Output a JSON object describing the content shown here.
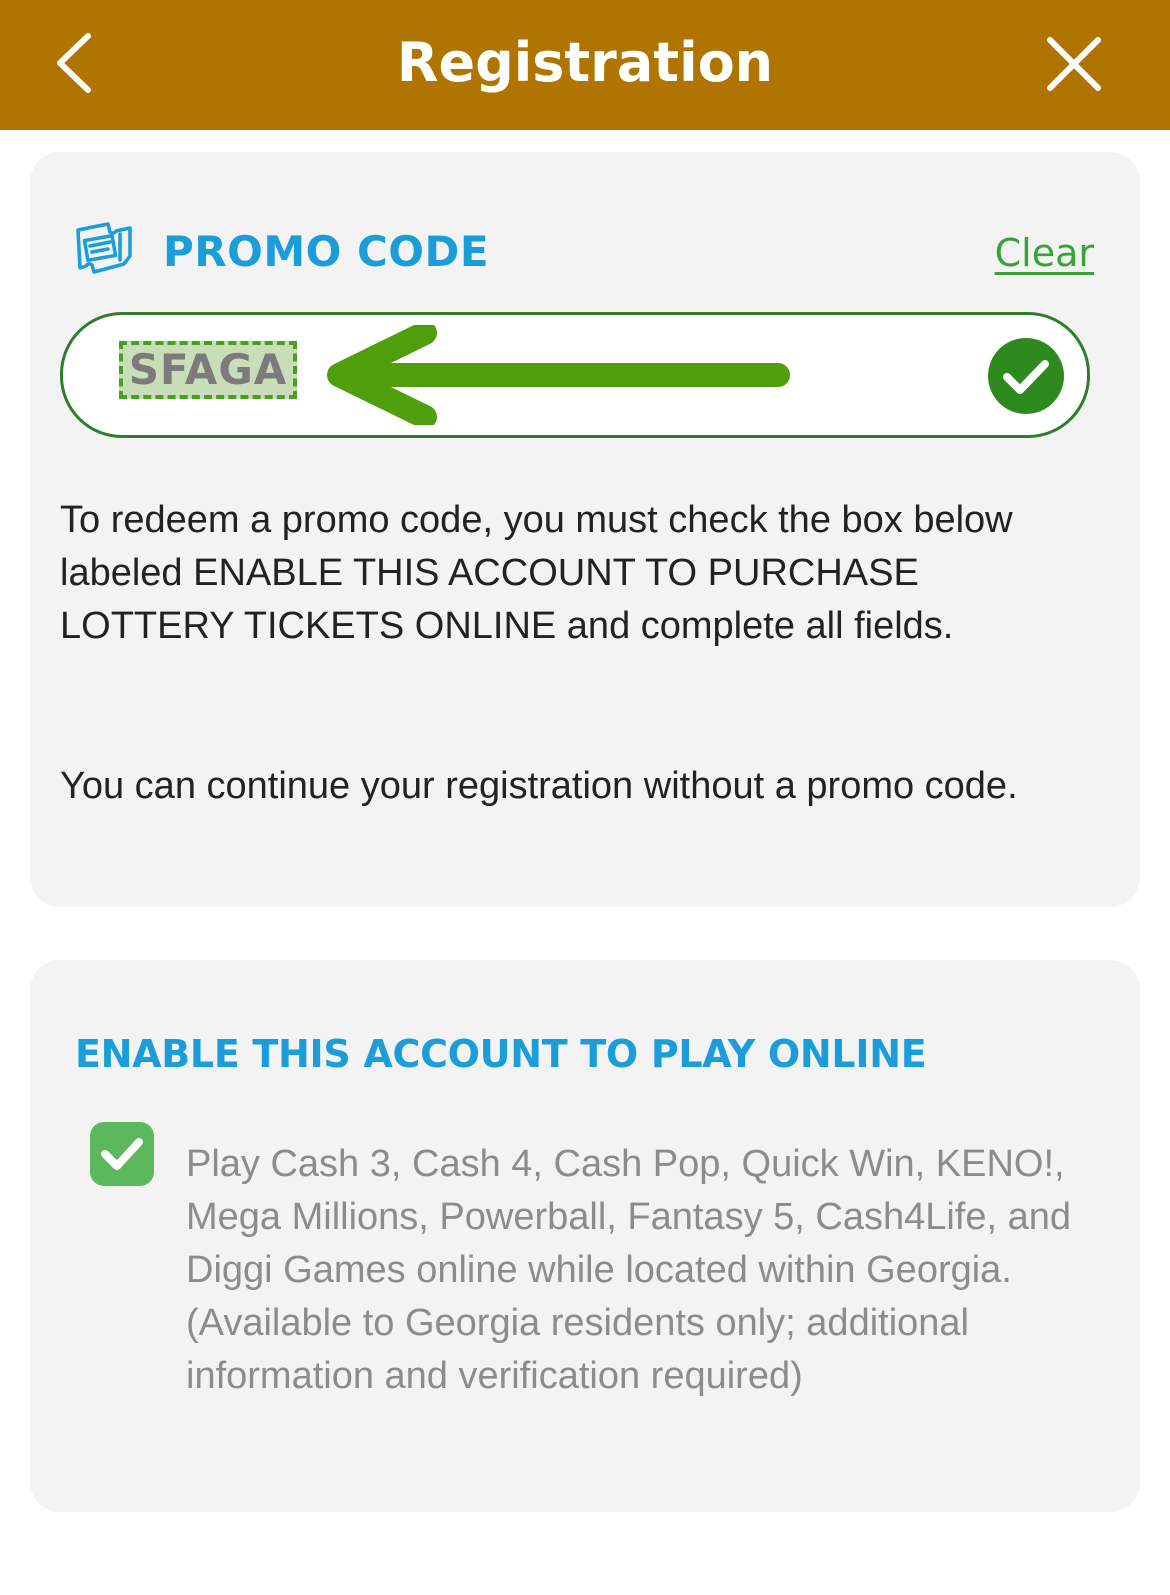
{
  "header": {
    "title": "Registration",
    "background_color": "#b07500",
    "back_icon": "chevron-left-icon",
    "close_icon": "close-icon"
  },
  "promo": {
    "heading": "PROMO CODE",
    "icon": "ticket-icon",
    "clear_label": "Clear",
    "code_value": "SFAGA",
    "status_icon": "check-circle-icon",
    "annotation_icon": "arrow-left-icon",
    "instructions": "To redeem a promo code, you must check the box below labeled ENABLE THIS ACCOUNT TO PURCHASE LOTTERY TICKETS ONLINE and complete all fields.",
    "optional_note": "You can continue your registration without a promo code."
  },
  "enable_online": {
    "heading": "ENABLE THIS ACCOUNT TO PLAY ONLINE",
    "checkbox_checked": true,
    "checkbox_icon": "checkmark-icon",
    "description": "Play Cash 3, Cash 4, Cash Pop, Quick Win, KENO!, Mega Millions, Powerball, Fantasy 5, Cash4Life, and Diggi Games online while located within Georgia. (Available to Georgia residents only; additional information and verification required)"
  },
  "colors": {
    "accent_blue": "#1a9dd9",
    "success_green": "#2f7d2c",
    "checkbox_green": "#5cb85c",
    "link_green": "#3aa335",
    "card_background": "#f3f3f3"
  }
}
